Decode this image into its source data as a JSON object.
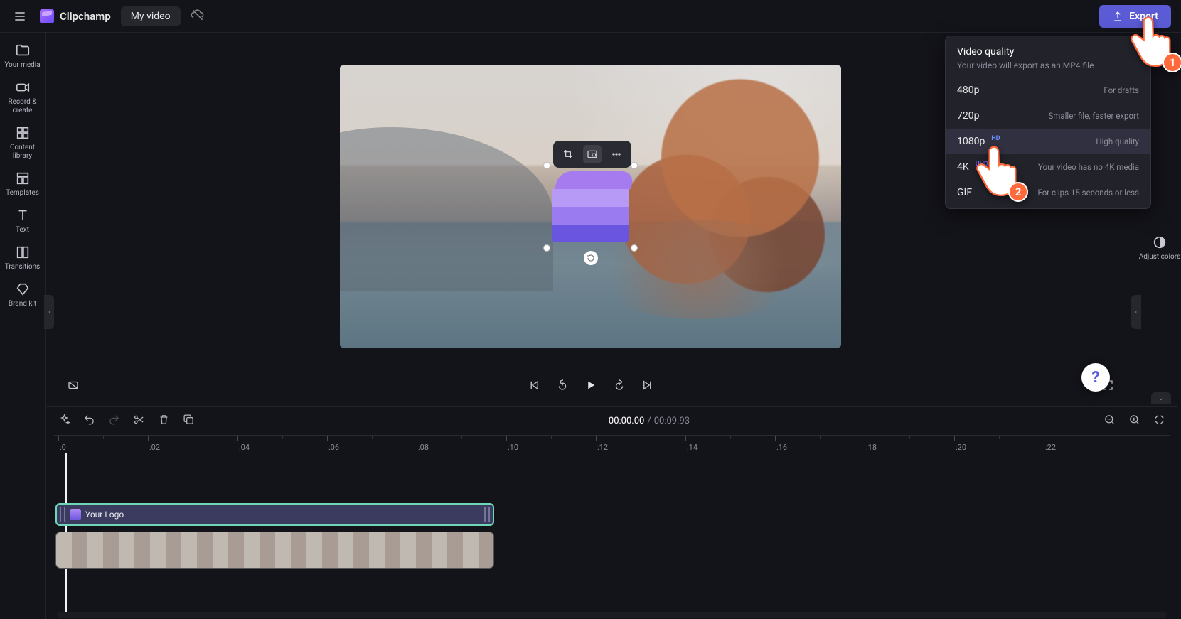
{
  "brand": "Clipchamp",
  "video_title": "My video",
  "export_label": "Export",
  "sidebar": {
    "items": [
      {
        "label": "Your media"
      },
      {
        "label": "Record & create"
      },
      {
        "label": "Content library"
      },
      {
        "label": "Templates"
      },
      {
        "label": "Text"
      },
      {
        "label": "Transitions"
      },
      {
        "label": "Brand kit"
      }
    ]
  },
  "right_panel": {
    "adjust_colors": "Adjust colors"
  },
  "export_menu": {
    "title": "Video quality",
    "subtitle": "Your video will export as an MP4 file",
    "options": [
      {
        "name": "480p",
        "badge": "",
        "desc": "For drafts"
      },
      {
        "name": "720p",
        "badge": "",
        "desc": "Smaller file, faster export"
      },
      {
        "name": "1080p",
        "badge": "HD",
        "desc": "High quality"
      },
      {
        "name": "4K",
        "badge": "UHD",
        "desc": "Your video has no 4K media"
      },
      {
        "name": "GIF",
        "badge": "",
        "desc": "For clips 15 seconds or less"
      }
    ],
    "selected_index": 2
  },
  "timeline": {
    "current": "00:00.00",
    "duration": "00:09.93",
    "ruler_labels": [
      ":0",
      ":02",
      ":04",
      ":06",
      ":08",
      ":10",
      ":12",
      ":14",
      ":16",
      ":18",
      ":20",
      ":22"
    ],
    "logo_clip_label": "Your Logo"
  },
  "tutorial": {
    "step1": "1",
    "step2": "2"
  },
  "help_label": "?"
}
